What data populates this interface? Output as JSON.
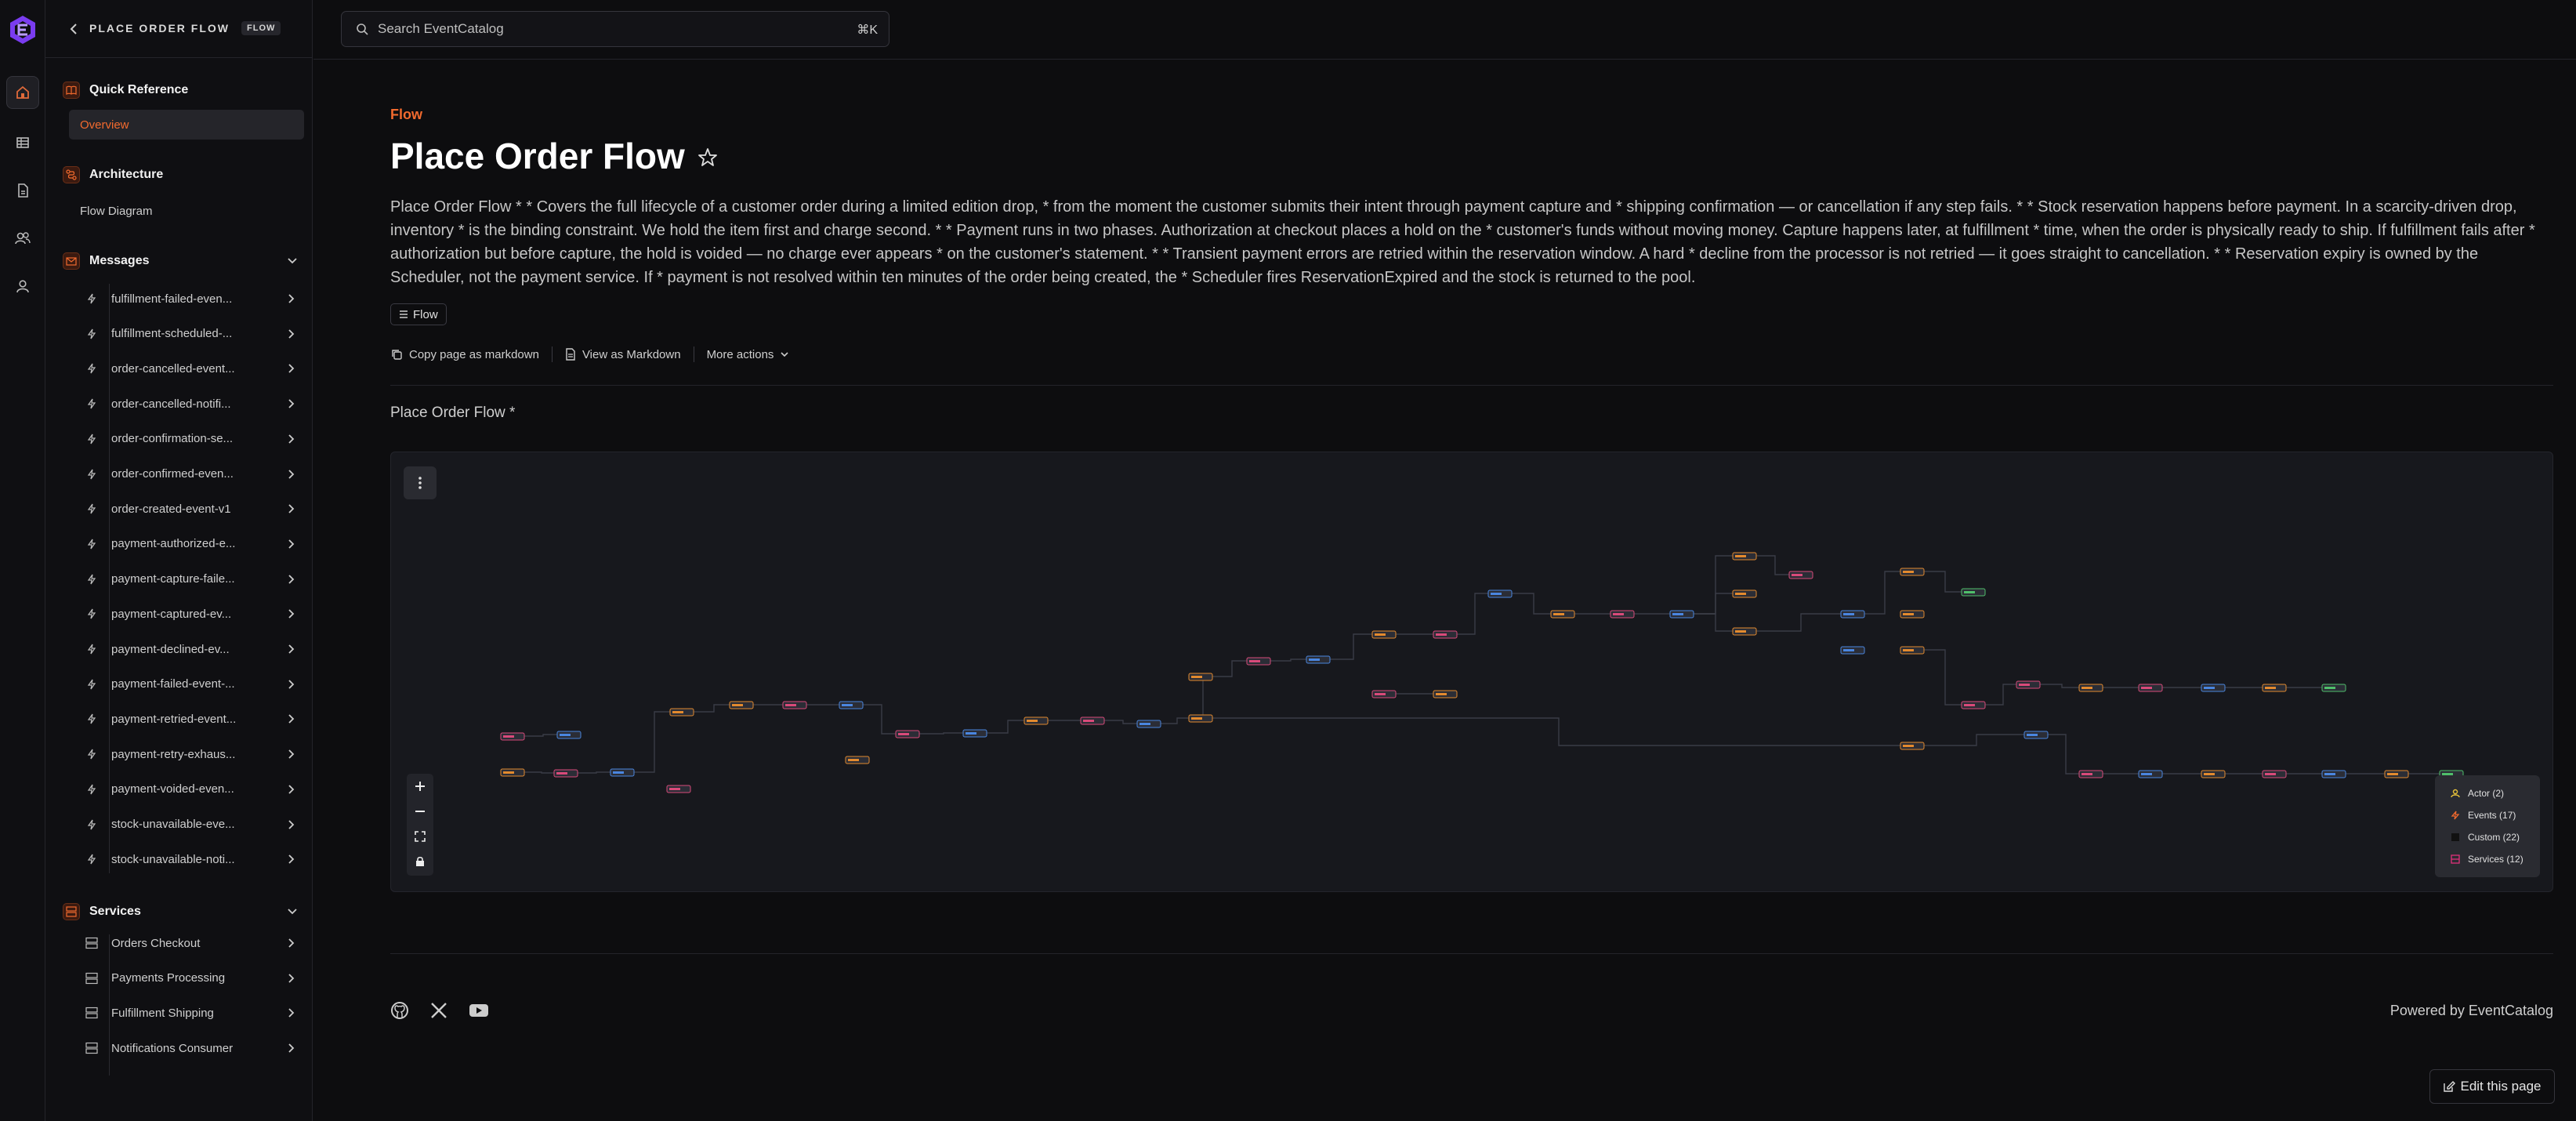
{
  "app": {
    "accent": "#f26a2e",
    "rail_icons": [
      "home-icon",
      "table-icon",
      "document-icon",
      "users-icon",
      "user-icon"
    ]
  },
  "sidebar": {
    "title": "PLACE ORDER FLOW",
    "tag": "FLOW",
    "sections": {
      "quick_reference": {
        "label": "Quick Reference",
        "items": [
          "Overview"
        ]
      },
      "architecture": {
        "label": "Architecture",
        "items": [
          "Flow Diagram"
        ]
      },
      "messages": {
        "label": "Messages",
        "items": [
          "fulfillment-failed-even...",
          "fulfillment-scheduled-...",
          "order-cancelled-event...",
          "order-cancelled-notifi...",
          "order-confirmation-se...",
          "order-confirmed-even...",
          "order-created-event-v1",
          "payment-authorized-e...",
          "payment-capture-faile...",
          "payment-captured-ev...",
          "payment-declined-ev...",
          "payment-failed-event-...",
          "payment-retried-event...",
          "payment-retry-exhaus...",
          "payment-voided-even...",
          "stock-unavailable-eve...",
          "stock-unavailable-noti..."
        ]
      },
      "services": {
        "label": "Services",
        "items": [
          "Orders Checkout",
          "Payments Processing",
          "Fulfillment Shipping",
          "Notifications Consumer"
        ]
      }
    }
  },
  "search": {
    "placeholder": "Search EventCatalog",
    "shortcut": "⌘K"
  },
  "page": {
    "eyebrow": "Flow",
    "title": "Place Order Flow",
    "description": "Place Order Flow * * Covers the full lifecycle of a customer order during a limited edition drop, * from the moment the customer submits their intent through payment capture and * shipping confirmation — or cancellation if any step fails. * * Stock reservation happens before payment. In a scarcity-driven drop, inventory * is the binding constraint. We hold the item first and charge second. * * Payment runs in two phases. Authorization at checkout places a hold on the * customer's funds without moving money. Capture happens later, at fulfillment * time, when the order is physically ready to ship. If fulfillment fails after * authorization but before capture, the hold is voided — no charge ever appears * on the customer's statement. * * Transient payment errors are retried within the reservation window. A hard * decline from the processor is not retried — it goes straight to cancellation. * * Reservation expiry is owned by the Scheduler, not the payment service. If * payment is not resolved within ten minutes of the order being created, the * Scheduler fires ReservationExpired and the stock is returned to the pool.",
    "pill": "Flow",
    "actions": {
      "copy": "Copy page as markdown",
      "view": "View as Markdown",
      "more": "More actions"
    },
    "diagram_title": "Place Order Flow *"
  },
  "legend": [
    {
      "label": "Actor (2)",
      "color": "#e7c23a"
    },
    {
      "label": "Events (17)",
      "color": "#f26a2e"
    },
    {
      "label": "Custom (22)",
      "color": "#111111"
    },
    {
      "label": "Services (12)",
      "color": "#e0307a"
    }
  ],
  "footer": {
    "powered": "Powered by EventCatalog",
    "edit": "Edit this page"
  }
}
